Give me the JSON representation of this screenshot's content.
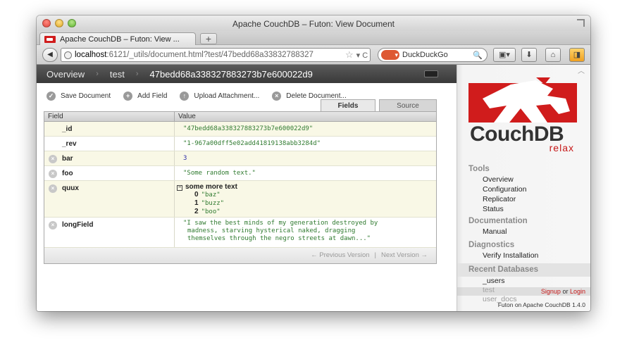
{
  "window": {
    "title": "Apache CouchDB – Futon: View Document"
  },
  "tab": {
    "label": "Apache CouchDB – Futon: View ...",
    "new_tab": "+"
  },
  "nav": {
    "url_host": "localhost",
    "url_path": ":6121/_utils/document.html?test/47bedd68a33832788327",
    "search_value": "DuckDuckGo"
  },
  "breadcrumb": {
    "overview": "Overview",
    "database": "test",
    "document": "47bedd68a338327883273b7e600022d9"
  },
  "actions": {
    "save": "Save Document",
    "add_field": "Add Field",
    "upload": "Upload Attachment...",
    "delete": "Delete Document..."
  },
  "tabs": {
    "fields": "Fields",
    "source": "Source"
  },
  "table": {
    "header_field": "Field",
    "header_value": "Value",
    "rows": {
      "id": {
        "key": "_id",
        "value": "\"47bedd68a338327883273b7e600022d9\""
      },
      "rev": {
        "key": "_rev",
        "value": "\"1-967a00dff5e02add41819138abb3284d\""
      },
      "bar": {
        "key": "bar",
        "value": "3"
      },
      "foo": {
        "key": "foo",
        "value": "\"Some random text.\""
      },
      "quux": {
        "key": "quux",
        "heading": "some more text",
        "items": [
          {
            "index": "0",
            "value": "\"baz\""
          },
          {
            "index": "1",
            "value": "\"buzz\""
          },
          {
            "index": "2",
            "value": "\"boo\""
          }
        ]
      },
      "longField": {
        "key": "longField",
        "lines": [
          "\"I saw the best minds of my generation destroyed by",
          "madness, starving hysterical naked, dragging",
          "themselves through the negro streets at dawn...\""
        ]
      }
    },
    "footer": {
      "previous": "← Previous Version",
      "separator": "|",
      "next": "Next Version →"
    }
  },
  "sidebar": {
    "logo_text": "CouchDB",
    "logo_tag": "relax",
    "tools": {
      "heading": "Tools",
      "items": [
        "Overview",
        "Configuration",
        "Replicator",
        "Status"
      ]
    },
    "documentation": {
      "heading": "Documentation",
      "items": [
        "Manual"
      ]
    },
    "diagnostics": {
      "heading": "Diagnostics",
      "items": [
        "Verify Installation"
      ]
    },
    "recent": {
      "heading": "Recent Databases",
      "items": [
        "_users",
        "test",
        "user_docs"
      ]
    },
    "login": {
      "signup": "Signup",
      "or": "or",
      "login": "Login"
    },
    "version": "Futon on Apache CouchDB 1.4.0"
  },
  "colors": {
    "couch_red": "#c61818",
    "value_green": "#2f7a2f",
    "row_yellow": "#f9f8e6",
    "breadcrumb_bg": "#393939"
  }
}
